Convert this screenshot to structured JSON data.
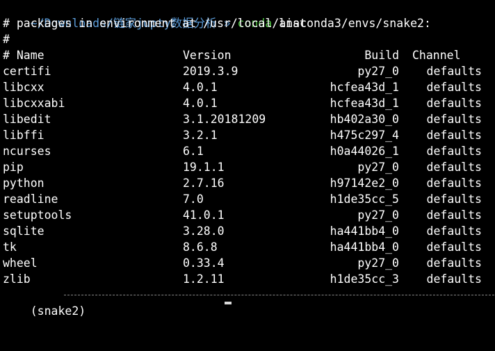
{
  "prompt": {
    "path": "~/Downloads/链家jupty数据分析",
    "arrow": "»",
    "command": "conda",
    "args": "list"
  },
  "comment_line": "# packages in environment at /usr/local/anaconda3/envs/snake2:",
  "hash_line": "#",
  "headers": {
    "name": "# Name",
    "version": "Version",
    "build": "Build",
    "channel": "Channel"
  },
  "packages": [
    {
      "name": "certifi",
      "version": "2019.3.9",
      "build": "py27_0",
      "channel": "defaults"
    },
    {
      "name": "libcxx",
      "version": "4.0.1",
      "build": "hcfea43d_1",
      "channel": "defaults"
    },
    {
      "name": "libcxxabi",
      "version": "4.0.1",
      "build": "hcfea43d_1",
      "channel": "defaults"
    },
    {
      "name": "libedit",
      "version": "3.1.20181209",
      "build": "hb402a30_0",
      "channel": "defaults"
    },
    {
      "name": "libffi",
      "version": "3.2.1",
      "build": "h475c297_4",
      "channel": "defaults"
    },
    {
      "name": "ncurses",
      "version": "6.1",
      "build": "h0a44026_1",
      "channel": "defaults"
    },
    {
      "name": "pip",
      "version": "19.1.1",
      "build": "py27_0",
      "channel": "defaults"
    },
    {
      "name": "python",
      "version": "2.7.16",
      "build": "h97142e2_0",
      "channel": "defaults"
    },
    {
      "name": "readline",
      "version": "7.0",
      "build": "h1de35cc_5",
      "channel": "defaults"
    },
    {
      "name": "setuptools",
      "version": "41.0.1",
      "build": "py27_0",
      "channel": "defaults"
    },
    {
      "name": "sqlite",
      "version": "3.28.0",
      "build": "ha441bb4_0",
      "channel": "defaults"
    },
    {
      "name": "tk",
      "version": "8.6.8",
      "build": "ha441bb4_0",
      "channel": "defaults"
    },
    {
      "name": "wheel",
      "version": "0.33.4",
      "build": "py27_0",
      "channel": "defaults"
    },
    {
      "name": "zlib",
      "version": "1.2.11",
      "build": "h1de35cc_3",
      "channel": "defaults"
    }
  ],
  "env_prompt": "(snake2)",
  "colors": {
    "background": "#000000",
    "text": "#ffffff",
    "path": "#5a9bd8",
    "command": "#4fc341"
  }
}
